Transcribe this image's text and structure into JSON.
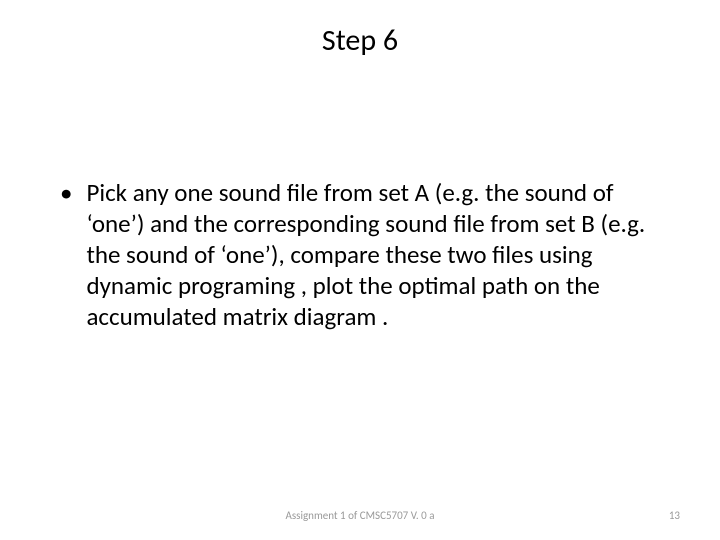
{
  "title": "Step 6",
  "bullet": "•",
  "body": "Pick any one sound file from set A (e.g. the sound of ‘one’) and the corresponding  sound file from set B (e.g. the sound of ‘one’), compare these two files using dynamic programing , plot the optimal path on the accumulated matrix diagram .",
  "footer": "Assignment 1 of CMSC5707 V. 0 a",
  "page_number": "13"
}
